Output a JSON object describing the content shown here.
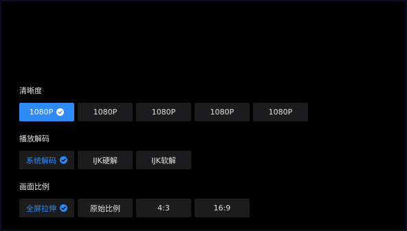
{
  "colors": {
    "background": "#000000",
    "border": "#0b0d24",
    "option_bg": "#1c1c1e",
    "accent": "#2f8af5",
    "text": "#e2e2e2"
  },
  "sections": [
    {
      "title": "清晰度",
      "options": [
        {
          "label": "1080P",
          "state": "selected",
          "icon": "check-circle-icon"
        },
        {
          "label": "1080P"
        },
        {
          "label": "1080P"
        },
        {
          "label": "1080P"
        },
        {
          "label": "1080P"
        }
      ]
    },
    {
      "title": "播放解码",
      "options": [
        {
          "label": "系统解码",
          "state": "active",
          "icon": "check-circle-icon"
        },
        {
          "label": "IJK硬解"
        },
        {
          "label": "IJK软解"
        }
      ]
    },
    {
      "title": "画面比例",
      "options": [
        {
          "label": "全屏拉伸",
          "state": "active",
          "icon": "check-circle-icon"
        },
        {
          "label": "原始比例"
        },
        {
          "label": "4:3"
        },
        {
          "label": "16:9"
        }
      ]
    }
  ]
}
